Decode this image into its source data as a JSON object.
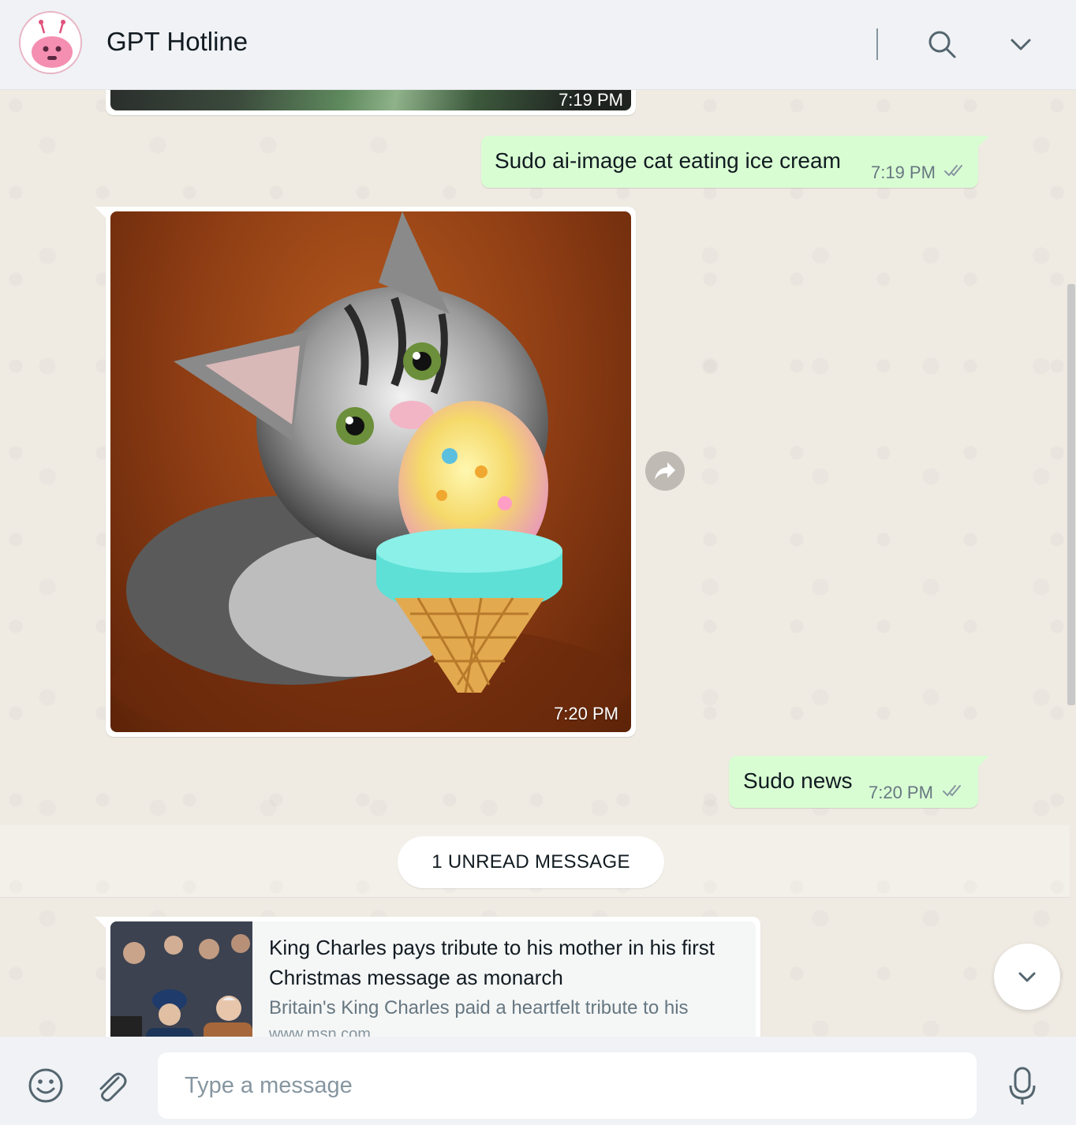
{
  "header": {
    "title": "GPT Hotline"
  },
  "messages": {
    "previous_image_time": "7:19 PM",
    "cat_request": {
      "text": "Sudo ai-image cat eating ice cream",
      "time": "7:19 PM"
    },
    "cat_image_time": "7:20 PM",
    "news_request": {
      "text": "Sudo news",
      "time": "7:20 PM"
    },
    "unread_label": "1 UNREAD MESSAGE",
    "news_card": {
      "title": "King Charles pays tribute to his mother in his first Christmas message as monarch",
      "description": "Britain's King Charles paid a heartfelt tribute to his",
      "url": "www.msn.com"
    }
  },
  "composer": {
    "placeholder": "Type a message"
  },
  "icons": {
    "search": "search-icon",
    "menu": "chevron-down-icon",
    "forward": "forward-icon",
    "emoji": "emoji-icon",
    "attach": "paperclip-icon",
    "mic": "microphone-icon",
    "read_receipt": "double-check-icon"
  },
  "colors": {
    "outgoing_bubble": "#d9fdd3",
    "incoming_bubble": "#ffffff",
    "chat_background": "#efeae2",
    "header_background": "#f0f2f5",
    "avatar_accent": "#f48fb1"
  }
}
